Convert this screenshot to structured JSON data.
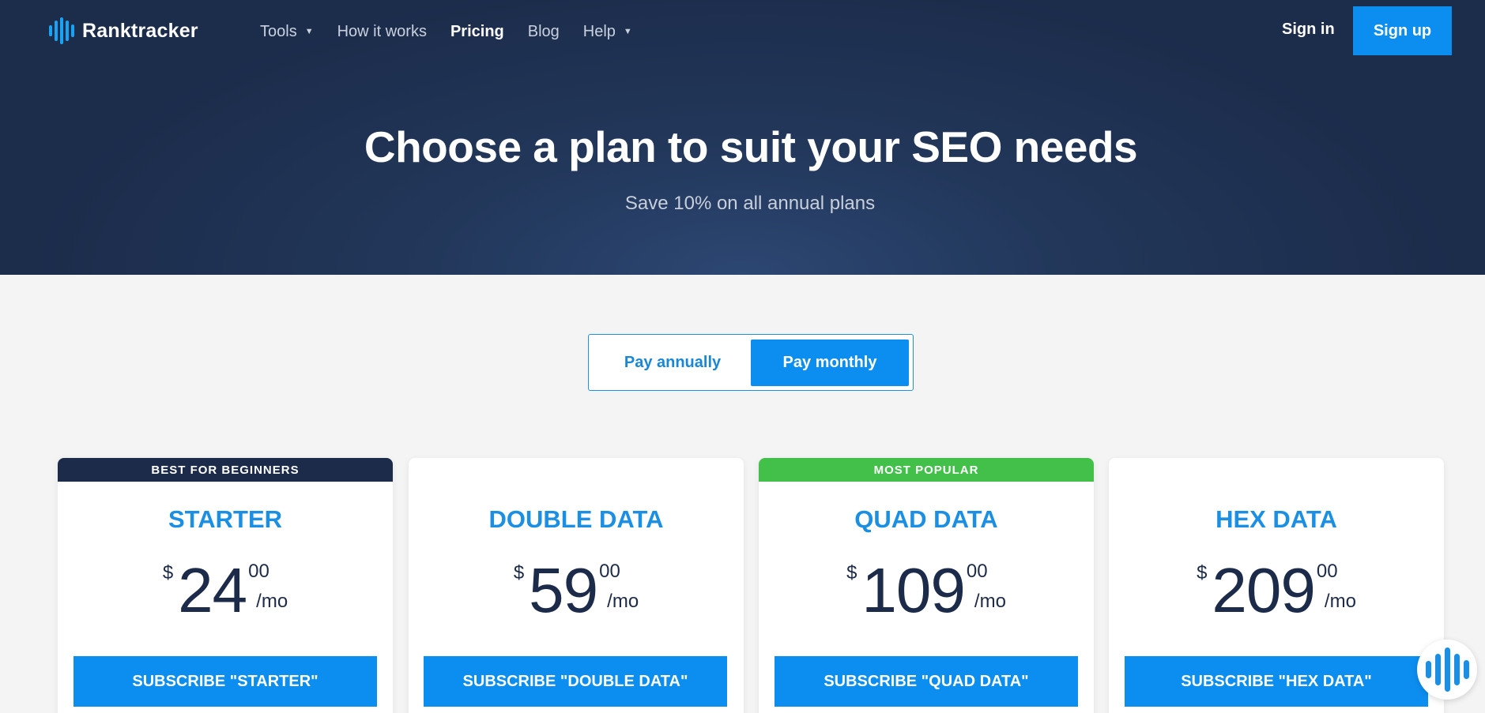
{
  "brand": {
    "name": "Ranktracker",
    "accent": "#0c8ef0",
    "navy": "#1c2c4b",
    "green": "#43c04a"
  },
  "nav": {
    "items": [
      {
        "label": "Tools",
        "dropdown": true,
        "active": false
      },
      {
        "label": "How it works",
        "dropdown": false,
        "active": false
      },
      {
        "label": "Pricing",
        "dropdown": false,
        "active": true
      },
      {
        "label": "Blog",
        "dropdown": false,
        "active": false
      },
      {
        "label": "Help",
        "dropdown": true,
        "active": false
      }
    ],
    "signin": "Sign in",
    "signup": "Sign up"
  },
  "hero": {
    "title": "Choose a plan to suit your SEO needs",
    "subtitle": "Save 10% on all annual plans"
  },
  "billing": {
    "annual": "Pay annually",
    "monthly": "Pay monthly",
    "selected": "monthly"
  },
  "plans": [
    {
      "ribbon": "BEST FOR BEGINNERS",
      "ribbon_color": "#1c2b49",
      "name": "STARTER",
      "currency": "$",
      "amount": "24",
      "cents": "00",
      "per": "/mo",
      "cta": "SUBSCRIBE \"STARTER\""
    },
    {
      "ribbon": "",
      "ribbon_color": "",
      "name": "DOUBLE DATA",
      "currency": "$",
      "amount": "59",
      "cents": "00",
      "per": "/mo",
      "cta": "SUBSCRIBE \"DOUBLE DATA\""
    },
    {
      "ribbon": "MOST POPULAR",
      "ribbon_color": "#43c04a",
      "name": "QUAD DATA",
      "currency": "$",
      "amount": "109",
      "cents": "00",
      "per": "/mo",
      "cta": "SUBSCRIBE \"QUAD DATA\""
    },
    {
      "ribbon": "",
      "ribbon_color": "",
      "name": "HEX DATA",
      "currency": "$",
      "amount": "209",
      "cents": "00",
      "per": "/mo",
      "cta": "SUBSCRIBE \"HEX DATA\""
    }
  ],
  "widget": {
    "icon": "chat-bars-icon"
  }
}
